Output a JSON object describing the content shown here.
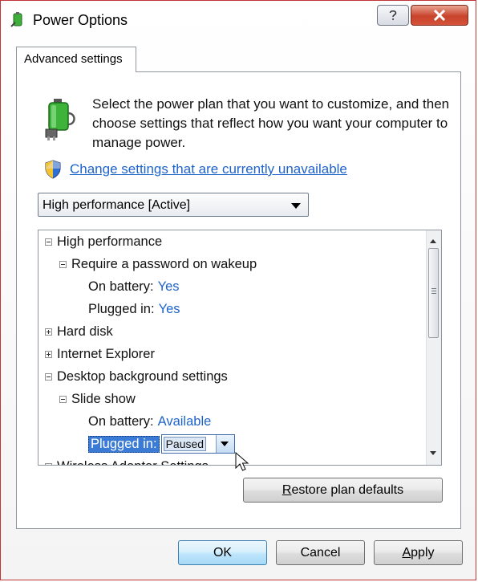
{
  "window": {
    "title": "Power Options"
  },
  "titlebar": {
    "help_icon": "question-mark-icon",
    "close_icon": "close-x-icon"
  },
  "tabs": [
    {
      "label": "Advanced settings"
    }
  ],
  "description": "Select the power plan that you want to customize, and then choose settings that reflect how you want your computer to manage power.",
  "change_link": "Change settings that are currently unavailable",
  "plan_select": {
    "value": "High performance [Active]"
  },
  "tree": {
    "rows": [
      {
        "label": "High performance",
        "expander": "minus"
      },
      {
        "label": "Require a password on wakeup",
        "expander": "minus"
      },
      {
        "label": "On battery:",
        "value": "Yes"
      },
      {
        "label": "Plugged in:",
        "value": "Yes"
      },
      {
        "label": "Hard disk",
        "expander": "plus"
      },
      {
        "label": "Internet Explorer",
        "expander": "plus"
      },
      {
        "label": "Desktop background settings",
        "expander": "minus"
      },
      {
        "label": "Slide show",
        "expander": "minus"
      },
      {
        "label": "On battery:",
        "value": "Available"
      },
      {
        "label": "Plugged in:",
        "value": "Paused"
      },
      {
        "label": "Wireless Adapter Settings",
        "expander": "plus"
      }
    ]
  },
  "buttons": {
    "restore_prefix": "R",
    "restore_rest": "estore plan defaults",
    "ok": "OK",
    "cancel": "Cancel",
    "apply_prefix": "A",
    "apply_rest": "pply"
  },
  "colors": {
    "link": "#1e63c9",
    "selection": "#3a7bd5",
    "window_border": "#c3343a"
  }
}
